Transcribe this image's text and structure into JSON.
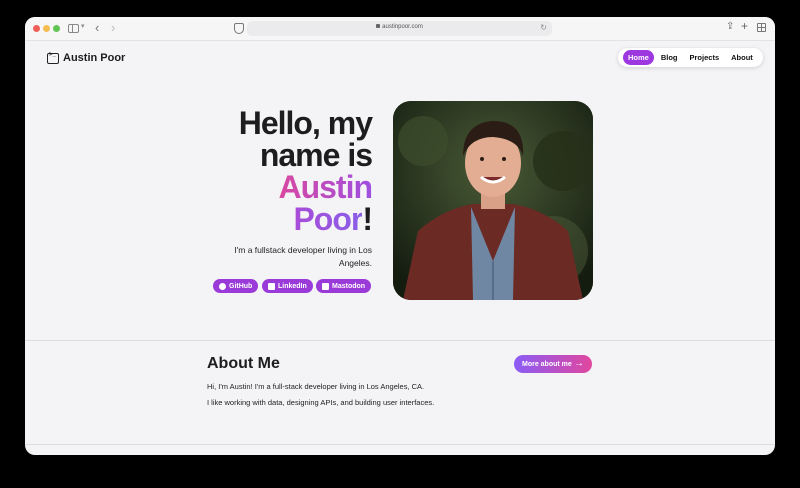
{
  "browser": {
    "url": "austinpoor.com"
  },
  "site": {
    "brand": "Austin Poor",
    "nav": [
      {
        "label": "Home",
        "active": true
      },
      {
        "label": "Blog",
        "active": false
      },
      {
        "label": "Projects",
        "active": false
      },
      {
        "label": "About",
        "active": false
      }
    ]
  },
  "hero": {
    "line1": "Hello, my",
    "line2": "name is",
    "name_first": "Austin",
    "name_last": "Poor",
    "exclaim": "!",
    "subtitle": "I'm a fullstack developer living in Los Angeles.",
    "links": [
      {
        "label": "GitHub",
        "icon": "github-icon"
      },
      {
        "label": "LinkedIn",
        "icon": "linkedin-icon"
      },
      {
        "label": "Mastodon",
        "icon": "mastodon-icon"
      }
    ]
  },
  "about": {
    "title": "About Me",
    "line1": "Hi, I'm Austin! I'm a full-stack developer living in Los Angeles, CA.",
    "line2": "I like working with data, designing APIs, and building user interfaces.",
    "more_label": "More about me"
  },
  "colors": {
    "accent": "#9d37e0",
    "gradient_start": "#d9489f",
    "gradient_end": "#9f4fe0"
  }
}
